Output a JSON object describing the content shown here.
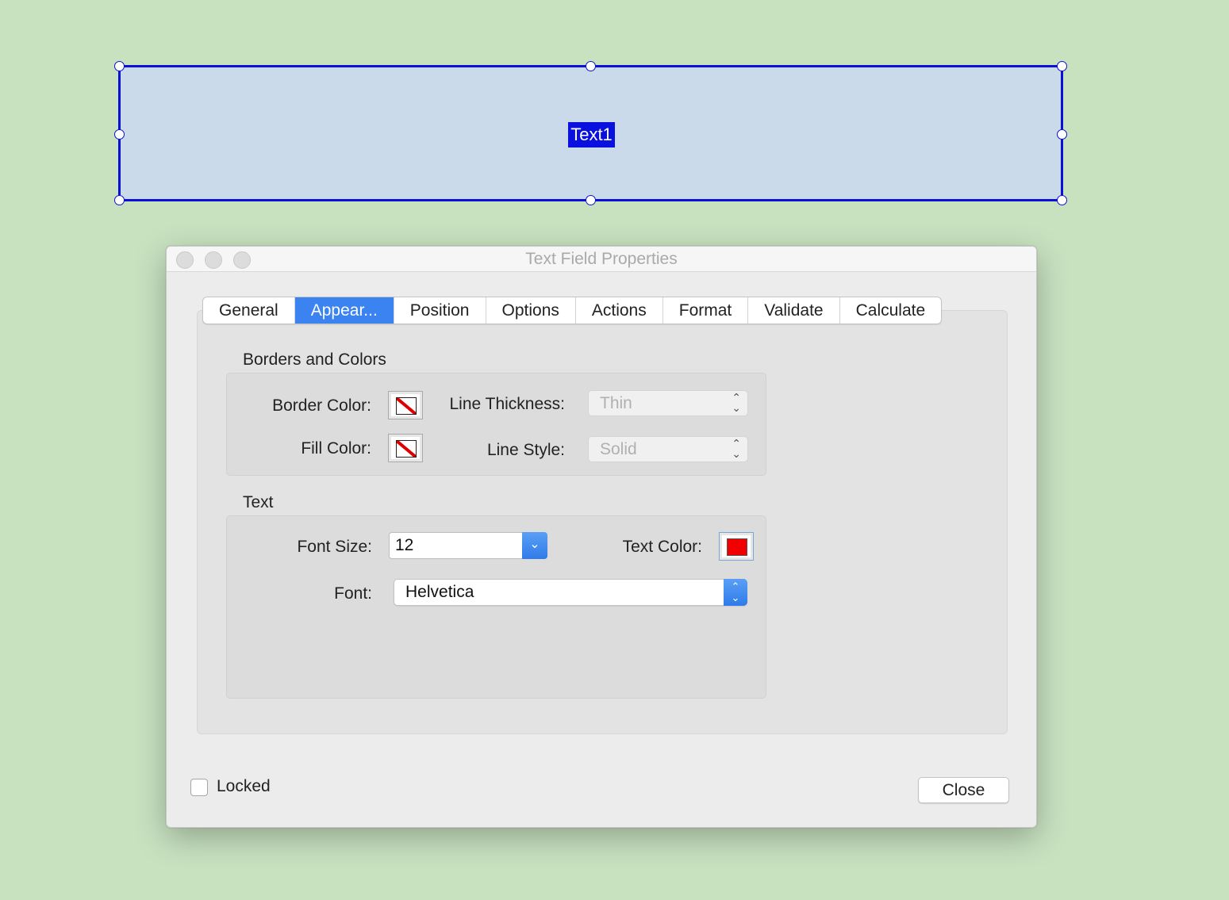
{
  "canvas": {
    "field_label": "Text1"
  },
  "dialog": {
    "title": "Text Field Properties",
    "tabs": [
      {
        "label": "General",
        "active": false
      },
      {
        "label": "Appear...",
        "active": true
      },
      {
        "label": "Position",
        "active": false
      },
      {
        "label": "Options",
        "active": false
      },
      {
        "label": "Actions",
        "active": false
      },
      {
        "label": "Format",
        "active": false
      },
      {
        "label": "Validate",
        "active": false
      },
      {
        "label": "Calculate",
        "active": false
      }
    ],
    "borders": {
      "heading": "Borders and Colors",
      "border_color_label": "Border Color:",
      "fill_color_label": "Fill Color:",
      "line_thickness_label": "Line Thickness:",
      "line_thickness_value": "Thin",
      "line_style_label": "Line Style:",
      "line_style_value": "Solid"
    },
    "text": {
      "heading": "Text",
      "font_size_label": "Font Size:",
      "font_size_value": "12",
      "text_color_label": "Text Color:",
      "text_color": "#f20000",
      "font_label": "Font:",
      "font_value": "Helvetica"
    },
    "locked_label": "Locked",
    "locked_checked": false,
    "close_label": "Close"
  },
  "colors": {
    "background": "#c8e2c0",
    "field_border": "#0a10d8",
    "field_fill": "#cbdaea",
    "accent": "#3a83f0"
  }
}
